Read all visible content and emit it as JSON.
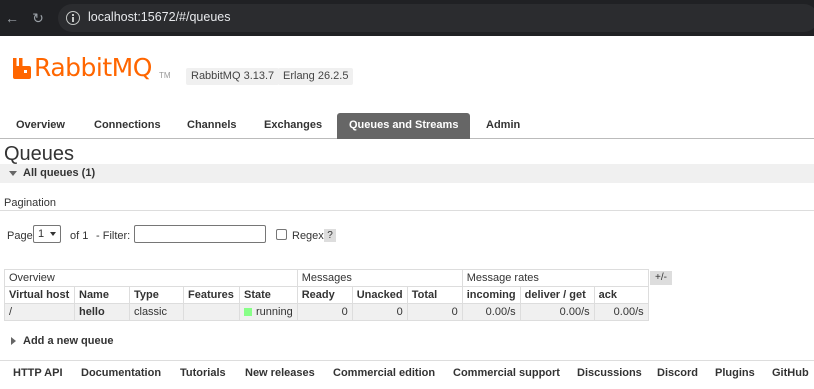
{
  "browser": {
    "url": "localhost:15672/#/queues",
    "back_icon": "arrow-back-icon",
    "reload_icon": "reload-icon",
    "info_icon": "info-icon"
  },
  "header": {
    "logo_text": "RabbitMQ",
    "logo_tm": "TM",
    "version": "RabbitMQ 3.13.7",
    "erlang": "Erlang 26.2.5"
  },
  "tabs": [
    {
      "label": "Overview"
    },
    {
      "label": "Connections"
    },
    {
      "label": "Channels"
    },
    {
      "label": "Exchanges"
    },
    {
      "label": "Queues and Streams",
      "active": true
    },
    {
      "label": "Admin"
    }
  ],
  "page_title": "Queues",
  "section": {
    "title": "All queues (1)"
  },
  "pagination": {
    "label": "Pagination",
    "page_label": "Page",
    "page_value": "1",
    "of_label": "of 1",
    "filter_label": "- Filter:",
    "filter_value": "",
    "regex_label": "Regex",
    "help_label": "?"
  },
  "table": {
    "groups": [
      "Overview",
      "Messages",
      "Message rates"
    ],
    "columns": [
      "Virtual host",
      "Name",
      "Type",
      "Features",
      "State",
      "Ready",
      "Unacked",
      "Total",
      "incoming",
      "deliver / get",
      "ack"
    ],
    "rows": [
      {
        "vhost": "/",
        "name": "hello",
        "type": "classic",
        "features": "",
        "state": "running",
        "ready": "0",
        "unacked": "0",
        "total": "0",
        "incoming": "0.00/s",
        "deliver": "0.00/s",
        "ack": "0.00/s"
      }
    ],
    "toggle_label": "+/-"
  },
  "add_queue": "Add a new queue",
  "footer": [
    "HTTP API",
    "Documentation",
    "Tutorials",
    "New releases",
    "Commercial edition",
    "Commercial support",
    "Discussions",
    "Discord",
    "Plugins",
    "GitHub"
  ],
  "colors": {
    "brand": "#ff6600",
    "active_tab": "#666666",
    "running": "#88ff88"
  }
}
